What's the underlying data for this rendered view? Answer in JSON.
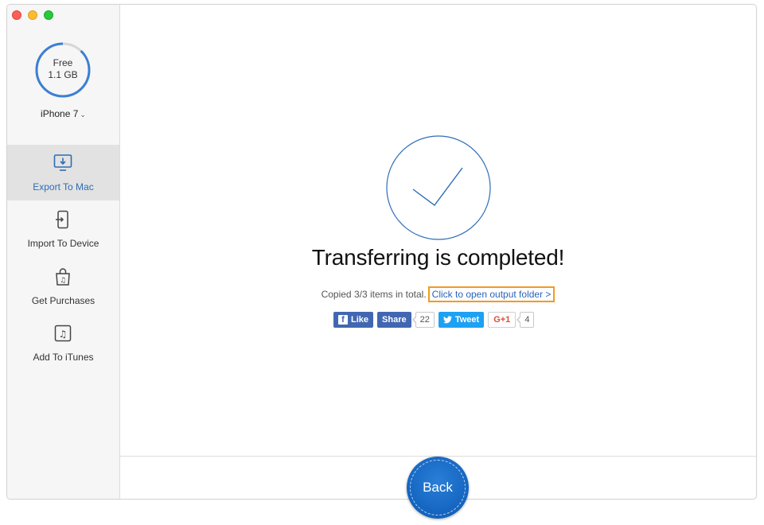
{
  "sidebar": {
    "storage": {
      "label": "Free",
      "amount": "1.1 GB",
      "used_fraction": 0.88
    },
    "device": {
      "name": "iPhone 7"
    },
    "items": [
      {
        "label": "Export To Mac",
        "icon": "monitor-download-icon",
        "active": true
      },
      {
        "label": "Import To Device",
        "icon": "phone-import-icon",
        "active": false
      },
      {
        "label": "Get Purchases",
        "icon": "shopping-bag-music-icon",
        "active": false
      },
      {
        "label": "Add To iTunes",
        "icon": "music-note-icon",
        "active": false
      }
    ]
  },
  "main": {
    "title": "Transferring is completed!",
    "copied_text": "Copied 3/3 items in total.",
    "open_folder_link": "Click to open output folder >",
    "social": {
      "like_label": "Like",
      "share_label": "Share",
      "share_count": "22",
      "tweet_label": "Tweet",
      "gplus_label": "G+1",
      "gplus_count": "4"
    },
    "back_label": "Back"
  },
  "colors": {
    "accent": "#2d6db5",
    "highlight_border": "#f39a1f",
    "back_button": "#1667c2",
    "facebook": "#4267b2",
    "twitter": "#1da1f2"
  }
}
